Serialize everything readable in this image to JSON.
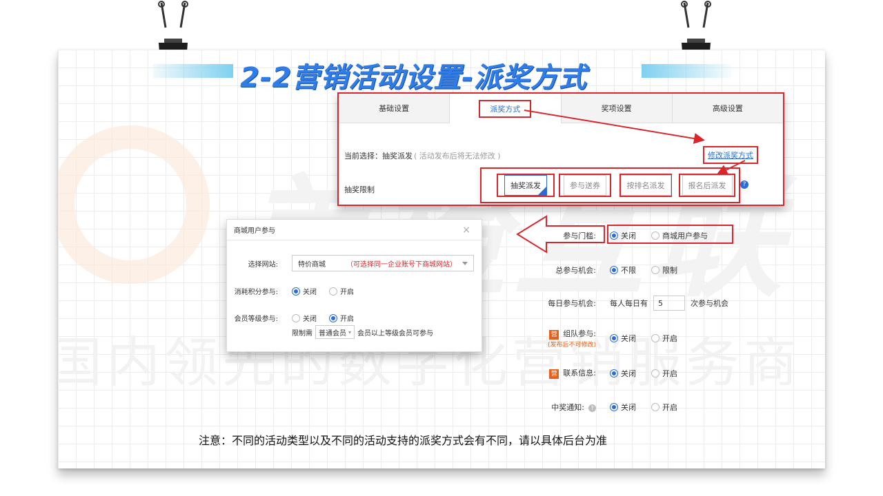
{
  "title": "2-2营销活动设置-派奖方式",
  "watermark": {
    "brand": "美橙互联",
    "slogan": "国内领先的数字化营销服务商"
  },
  "tabs": [
    {
      "label": "基础设置",
      "active": false
    },
    {
      "label": "派奖方式",
      "active": true
    },
    {
      "label": "奖项设置",
      "active": false
    },
    {
      "label": "高级设置",
      "active": false
    }
  ],
  "current": {
    "label": "当前选择：抽奖派发",
    "note": "( 活动发布后将无法修改 )",
    "modify_link": "修改派奖方式"
  },
  "limit_label": "抽奖限制",
  "methods": [
    {
      "label": "抽奖派发",
      "selected": true
    },
    {
      "label": "参与送券",
      "selected": false
    },
    {
      "label": "按排名派发",
      "selected": false
    },
    {
      "label": "报名后派发",
      "selected": false
    }
  ],
  "help_icon": "?",
  "modal": {
    "title": "商城用户参与",
    "close": "×",
    "site_label": "选择网站:",
    "site_value": "特价商城",
    "site_hint": "（可选择同一企业账号下商城网站）",
    "points_label": "消耗积分参与:",
    "points_options": [
      "关闭",
      "开启"
    ],
    "points_selected": 0,
    "level_label": "会员等级参与:",
    "level_options": [
      "关闭",
      "开启"
    ],
    "level_selected": 1,
    "limit_prefix": "限制需",
    "limit_select": "普通会员",
    "limit_suffix": "会员以上等级会员可参与"
  },
  "form": {
    "threshold": {
      "label": "参与门槛:",
      "options": [
        "关闭",
        "商城用户参与"
      ],
      "selected": 0
    },
    "total_chance": {
      "label": "总参与机会:",
      "options": [
        "不限",
        "限制"
      ],
      "selected": 0
    },
    "daily_chance": {
      "label": "每日参与机会:",
      "prefix": "每人每日有",
      "value": "5",
      "suffix": "次参与机会"
    },
    "team": {
      "badge": "营",
      "label": "组队参与:",
      "warn": "(发布后不可修改)",
      "options": [
        "关闭",
        "开启"
      ],
      "selected": 0
    },
    "contact": {
      "badge": "营",
      "label": "联系信息:",
      "options": [
        "关闭",
        "开启"
      ],
      "selected": 0
    },
    "notify": {
      "label": "中奖通知:",
      "options": [
        "关闭",
        "开启"
      ],
      "selected": 0,
      "help": "?"
    }
  },
  "note": "注意：不同的活动类型以及不同的活动支持的派奖方式会有不同，请以具体后台为准",
  "colors": {
    "accent_blue": "#2a6bd8",
    "highlight_red": "#d9262c",
    "title_blue": "#2f7de8",
    "badge_orange": "#e8601c"
  }
}
